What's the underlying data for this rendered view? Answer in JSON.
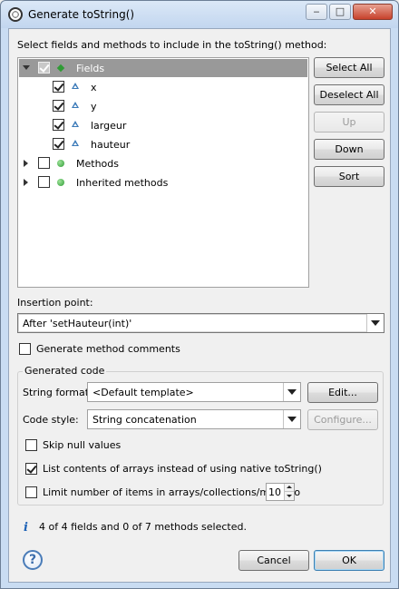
{
  "window": {
    "title": "Generate toString()",
    "controls": {
      "minimize": "‒",
      "maximize": "□",
      "close": "✕"
    }
  },
  "instructions": "Select fields and methods to include in the toString() method:",
  "tree": {
    "rows": [
      {
        "label": "Fields",
        "checked": true,
        "expanded": true,
        "icon": "fields-group-icon",
        "selected": true
      },
      {
        "label": "x",
        "checked": true,
        "icon": "field-icon"
      },
      {
        "label": "y",
        "checked": true,
        "icon": "field-icon"
      },
      {
        "label": "largeur",
        "checked": true,
        "icon": "field-icon"
      },
      {
        "label": "hauteur",
        "checked": true,
        "icon": "field-icon"
      },
      {
        "label": "Methods",
        "checked": false,
        "expanded": false,
        "icon": "method-icon"
      },
      {
        "label": "Inherited methods",
        "checked": false,
        "expanded": false,
        "icon": "method-icon"
      }
    ]
  },
  "side_buttons": {
    "select_all": "Select All",
    "deselect_all": "Deselect All",
    "up": "Up",
    "down": "Down",
    "sort": "Sort"
  },
  "insertion_point": {
    "label": "Insertion point:",
    "value": "After 'setHauteur(int)'"
  },
  "generate_comments": {
    "label": "Generate method comments",
    "checked": false
  },
  "generated_code": {
    "legend": "Generated code",
    "string_format": {
      "label": "String format:",
      "value": "<Default template>",
      "edit_button": "Edit..."
    },
    "code_style": {
      "label": "Code style:",
      "value": "String concatenation",
      "configure_button": "Configure..."
    },
    "skip_null": {
      "label": "Skip null values",
      "checked": false
    },
    "list_arrays": {
      "label": "List contents of arrays instead of using native toString()",
      "checked": true
    },
    "limit_items": {
      "label": "Limit number of items in arrays/collections/maps to",
      "checked": false,
      "value": "10"
    }
  },
  "status": "4 of 4 fields and 0 of 7 methods selected.",
  "footer": {
    "help": "?",
    "cancel": "Cancel",
    "ok": "OK"
  },
  "colors": {
    "selection": "#999999",
    "default_button_border": "#3c7fb1",
    "info": "#1d62b6"
  }
}
